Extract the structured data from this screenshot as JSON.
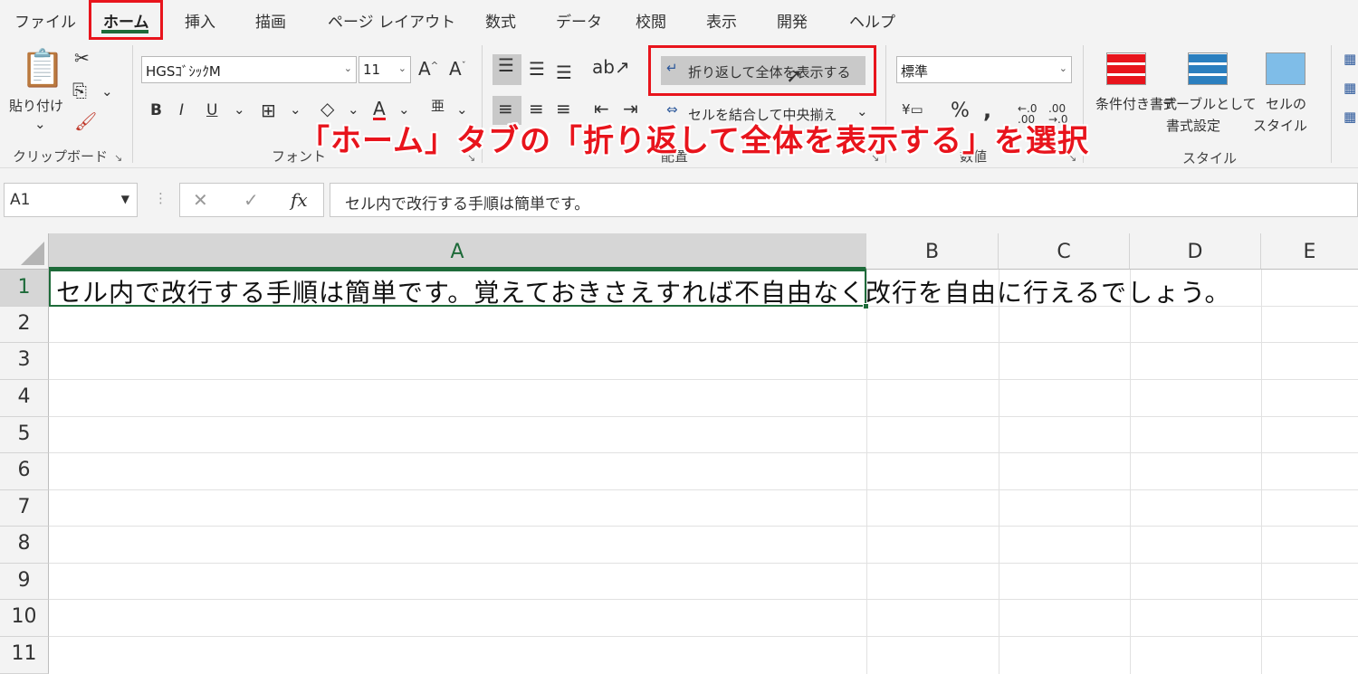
{
  "tabs": [
    "ファイル",
    "ホーム",
    "挿入",
    "描画",
    "ページ レイアウト",
    "数式",
    "データ",
    "校閲",
    "表示",
    "開発",
    "ヘルプ"
  ],
  "clipboard": {
    "paste": "貼り付け",
    "label": "クリップボード"
  },
  "font": {
    "name": "HGSｺﾞｼｯｸM",
    "size": "11",
    "label": "フォント"
  },
  "alignment": {
    "wrap": "折り返して全体を表示する",
    "merge": "セルを結合して中央揃え",
    "label": "配置"
  },
  "number": {
    "format": "標準",
    "label": "数値"
  },
  "styles": {
    "cond": "条件付き書式",
    "table1": "テーブルとして",
    "table2": "書式設定",
    "cell1": "セルの",
    "cell2": "スタイル",
    "label": "スタイル"
  },
  "annotation": "「ホーム」タブの「折り返して全体を表示する」を選択",
  "formula_bar": {
    "namebox": "A1",
    "content": "セル内で改行する手順は簡単です。"
  },
  "sheet": {
    "columns": [
      "A",
      "B",
      "C",
      "D",
      "E"
    ],
    "rows": [
      "1",
      "2",
      "3",
      "4",
      "5",
      "6",
      "7",
      "8",
      "9",
      "10",
      "11"
    ],
    "a1": "セル内で改行する手順は簡単です。覚えておきさえすれば不自由なく改行を自由に行えるでしょう。"
  },
  "colors": {
    "accent": "#1e6b3a",
    "highlight": "#e8141c"
  }
}
